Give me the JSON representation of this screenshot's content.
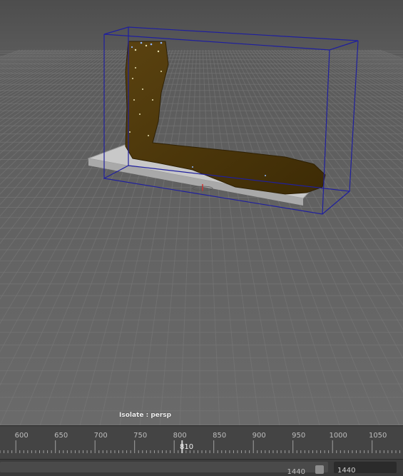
{
  "viewport": {
    "isolate_label": "Isolate : persp",
    "colors": {
      "grid_line": "#7a7a7a",
      "bounding_box": "#1f1f9e",
      "fluid": "#4a3508",
      "platform": "#c8c8c8"
    }
  },
  "timeline": {
    "ticks": [
      "600",
      "650",
      "700",
      "750",
      "800",
      "850",
      "900",
      "950",
      "1000",
      "1050"
    ],
    "current_frame": "810"
  },
  "range_bar": {
    "end_time": "1440",
    "playback_end": "1440"
  }
}
